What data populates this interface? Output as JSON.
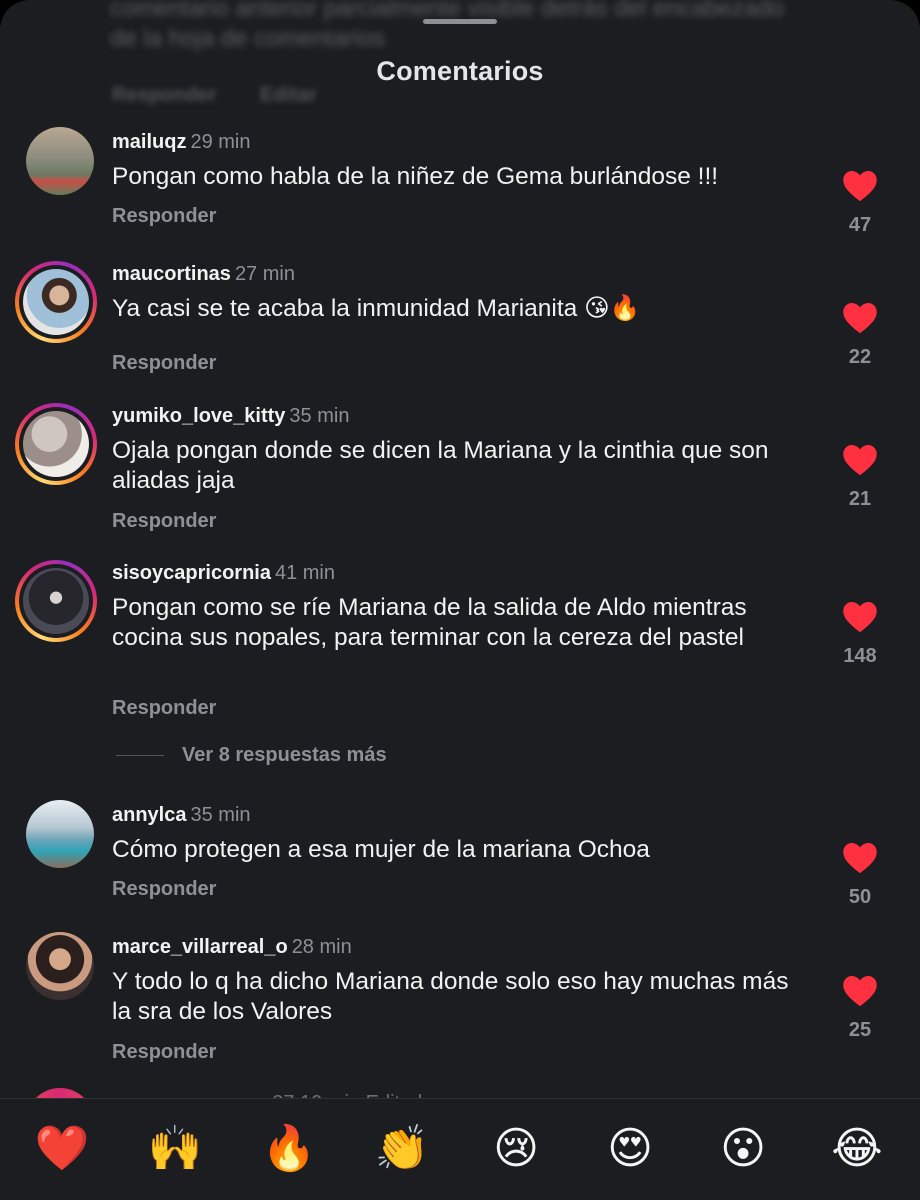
{
  "sheet": {
    "title": "Comentarios"
  },
  "ghost": {
    "text": "comentario anterior parcialmente visible detrás del encabezado de la hoja de comentarios",
    "reply_label": "Responder",
    "edit_label": "Editar"
  },
  "comments": [
    {
      "username": "mailuqz",
      "time": "29 min",
      "text": "Pongan como habla de  la niñez de Gema burlándose !!!",
      "reply_label": "Responder",
      "likes": "47",
      "story_ring": false
    },
    {
      "username": "maucortinas",
      "time": "27 min",
      "text": "Ya casi se te acaba la inmunidad Marianita 😘🔥",
      "reply_label": "Responder",
      "likes": "22",
      "story_ring": true
    },
    {
      "username": "yumiko_love_kitty",
      "time": "35 min",
      "text": "Ojala pongan donde se dicen la Mariana y la cinthia que son aliadas jaja",
      "reply_label": "Responder",
      "likes": "21",
      "story_ring": true
    },
    {
      "username": "sisoycapricornia",
      "time": "41 min",
      "text": "Pongan como se ríe Mariana de la salida de Aldo mientras cocina sus nopales, para terminar con la cereza del pastel",
      "reply_label": "Responder",
      "likes": "148",
      "story_ring": true
    },
    {
      "username": "annylca",
      "time": "35 min",
      "text": "Cómo protegen a esa mujer de la mariana Ochoa",
      "reply_label": "Responder",
      "likes": "50",
      "story_ring": false
    },
    {
      "username": "marce_villarreal_o",
      "time": "28 min",
      "text": "Y todo lo q ha dicho Mariana donde solo eso hay muchas más la sra de los Valores",
      "reply_label": "Responder",
      "likes": "25",
      "story_ring": false
    }
  ],
  "view_replies": {
    "label": "Ver 8 respuestas más"
  },
  "partial_row": {
    "text": "... 37  10 min  Editado"
  },
  "emoji_bar": [
    "❤️",
    "🙌",
    "🔥",
    "👏",
    "😢",
    "😍",
    "😮",
    "😂"
  ],
  "colors": {
    "background": "#1c1d20",
    "heart": "#ff3040",
    "muted": "#8f9097"
  }
}
